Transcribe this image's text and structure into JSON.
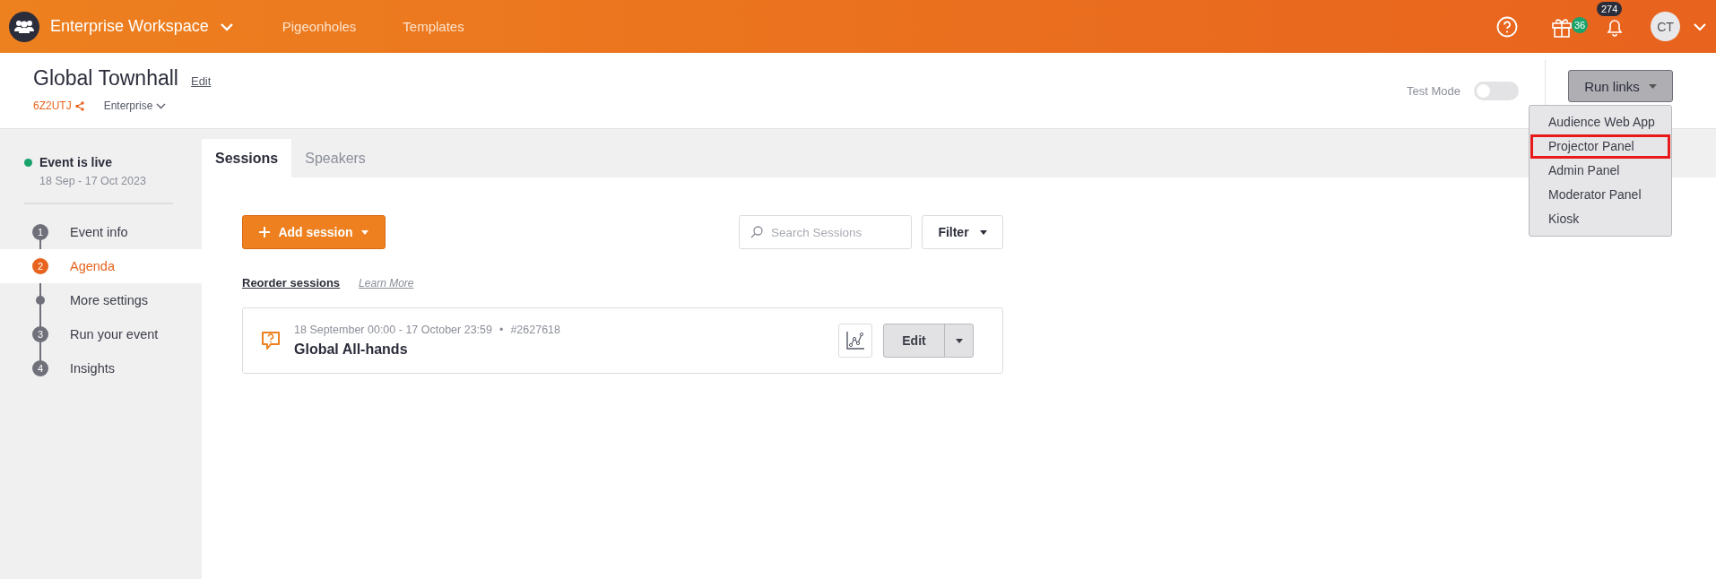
{
  "header": {
    "workspace": "Enterprise Workspace",
    "nav": [
      "Pigeonholes",
      "Templates"
    ],
    "gift_badge": "36",
    "notifications_badge": "274",
    "avatar": "CT"
  },
  "event": {
    "title": "Global Townhall",
    "edit_link": "Edit",
    "code": "6Z2UTJ",
    "plan": "Enterprise",
    "test_mode": {
      "label": "Test Mode",
      "on": false
    },
    "run_links_button": "Run links"
  },
  "run_links_menu": [
    {
      "label": "Audience Web App",
      "highlighted": false
    },
    {
      "label": "Projector Panel",
      "highlighted": true
    },
    {
      "label": "Admin Panel",
      "highlighted": false
    },
    {
      "label": "Moderator Panel",
      "highlighted": false
    },
    {
      "label": "Kiosk",
      "highlighted": false
    }
  ],
  "sidebar": {
    "status": "Event is live",
    "dates": "18 Sep - 17 Oct 2023",
    "steps": [
      {
        "kind": "numbered",
        "number": "1",
        "label": "Event info",
        "selected": false
      },
      {
        "kind": "numbered",
        "number": "2",
        "label": "Agenda",
        "selected": true
      },
      {
        "kind": "dot",
        "label": "More settings",
        "selected": false
      },
      {
        "kind": "numbered",
        "number": "3",
        "label": "Run your event",
        "selected": false
      },
      {
        "kind": "numbered",
        "number": "4",
        "label": "Insights",
        "selected": false
      }
    ]
  },
  "tabs": [
    {
      "label": "Sessions",
      "selected": true
    },
    {
      "label": "Speakers",
      "selected": false
    }
  ],
  "toolbar": {
    "add_session": "Add session",
    "search": {
      "placeholder": "Search Sessions"
    },
    "filter": "Filter"
  },
  "links": {
    "reorder": "Reorder sessions",
    "learn_more": "Learn More"
  },
  "sessions": [
    {
      "schedule": "18 September 00:00 - 17 October 23:59",
      "separator": "•",
      "id": "#2627618",
      "title": "Global All-hands",
      "edit": "Edit"
    }
  ]
}
